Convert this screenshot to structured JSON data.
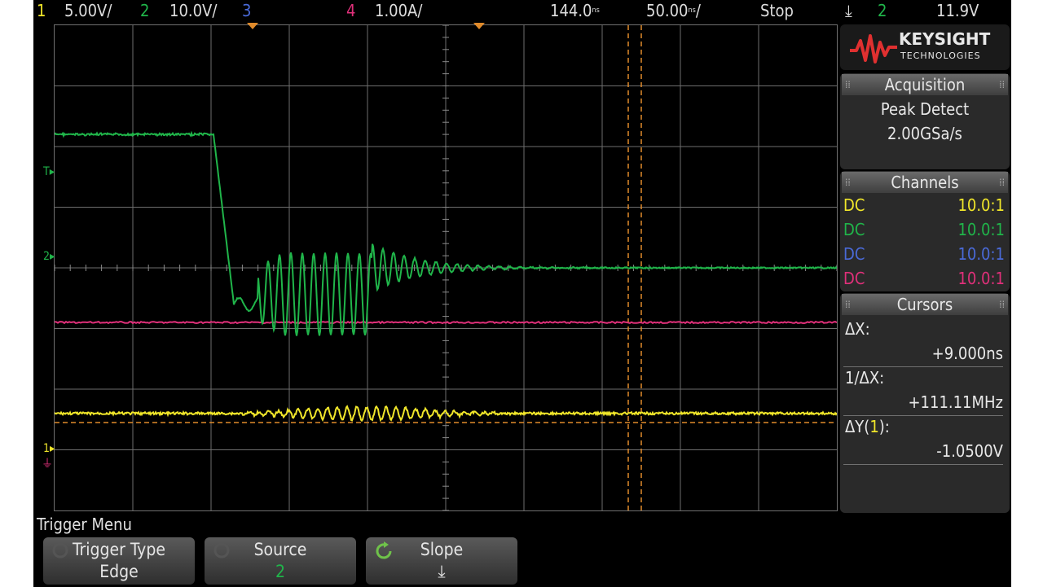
{
  "colors": {
    "ch1": "#f0e62a",
    "ch2": "#20b54a",
    "ch3": "#4a6ad8",
    "ch4": "#e0307a",
    "cursor": "#e08a2a",
    "grid": "#6e6e6e"
  },
  "status_bar": {
    "ch1_num": "1",
    "ch1_scale": "5.00V/",
    "ch2_num": "2",
    "ch2_scale": "10.0V/",
    "ch3_num": "3",
    "ch4_num": "4",
    "ch4_scale": "1.00A/",
    "time_position": "144.0",
    "time_position_unit": "ns",
    "timebase": "50.00",
    "timebase_unit": "ns",
    "timebase_suffix": "/",
    "run_state": "Stop",
    "trigger_slope_symbol": "⤓",
    "trigger_source": "2",
    "trigger_level": "11.9V"
  },
  "brand": {
    "line1": "KEYSIGHT",
    "line2": "TECHNOLOGIES"
  },
  "acquisition": {
    "header": "Acquisition",
    "mode": "Peak Detect",
    "rate": "2.00GSa/s"
  },
  "channels": {
    "header": "Channels",
    "rows": [
      {
        "coupling": "DC",
        "probe": "10.0:1"
      },
      {
        "coupling": "DC",
        "probe": "10.0:1"
      },
      {
        "coupling": "DC",
        "probe": "10.0:1"
      },
      {
        "coupling": "DC",
        "probe": "10.0:1"
      }
    ]
  },
  "cursors": {
    "header": "Cursors",
    "dx_label": "ΔX:",
    "dx_value": "+9.000ns",
    "inv_dx_label": "1/ΔX:",
    "inv_dx_value": "+111.11MHz",
    "dy_label_prefix": "ΔY(",
    "dy_label_channel": "1",
    "dy_label_suffix": "):",
    "dy_value": "-1.0500V"
  },
  "plot_markers": {
    "trigger_marker": "T",
    "ch2_marker": "2",
    "ch1_marker": "1"
  },
  "trigger_menu": {
    "title": "Trigger Menu",
    "softkeys": [
      {
        "label": "Trigger Type",
        "value": "Edge"
      },
      {
        "label": "Source",
        "value": "2"
      },
      {
        "label": "Slope",
        "value": "⤓"
      }
    ]
  },
  "trace_levels": {
    "ch2_high_div": 2.2,
    "ch2_low_div": -0.6,
    "ch2_settled_div": 0.0,
    "ch4_level_div": -0.9,
    "ch1_level_div": -2.4,
    "cursor_ref_div": -2.55
  }
}
